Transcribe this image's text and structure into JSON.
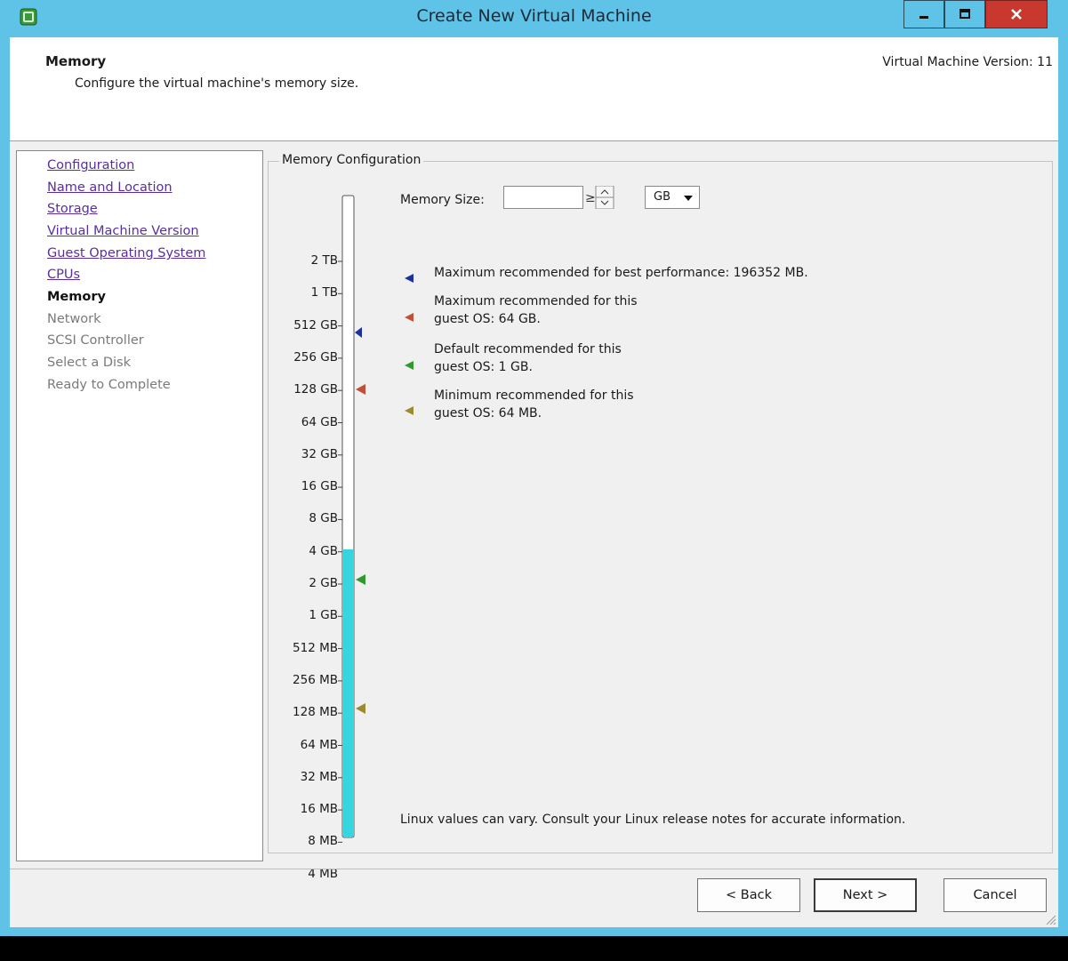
{
  "window": {
    "title": "Create New Virtual Machine",
    "app_icon": "vsphere-client-icon",
    "controls": {
      "minimize_icon": "minimize-icon",
      "maximize_icon": "maximize-icon",
      "close_icon": "close-icon"
    }
  },
  "header": {
    "title": "Memory",
    "subtitle": "Configure the virtual machine's memory size.",
    "version": "Virtual Machine Version: 11"
  },
  "steps": [
    {
      "label": "Configuration",
      "state": "done"
    },
    {
      "label": "Name and Location",
      "state": "done"
    },
    {
      "label": "Storage",
      "state": "done"
    },
    {
      "label": "Virtual Machine Version",
      "state": "done"
    },
    {
      "label": "Guest Operating System",
      "state": "done"
    },
    {
      "label": "CPUs",
      "state": "done"
    },
    {
      "label": "Memory",
      "state": "current"
    },
    {
      "label": "Network",
      "state": "pending"
    },
    {
      "label": "SCSI Controller",
      "state": "pending"
    },
    {
      "label": "Select a Disk",
      "state": "pending"
    },
    {
      "label": "Ready to Complete",
      "state": "pending"
    }
  ],
  "memory_config": {
    "group_label": "Memory Configuration",
    "size_label": "Memory Size:",
    "size_value": "",
    "unit": "GB",
    "scale_labels": [
      "2 TB",
      "1 TB",
      "512 GB",
      "256 GB",
      "128 GB",
      "64 GB",
      "32 GB",
      "16 GB",
      "8 GB",
      "4 GB",
      "2 GB",
      "1 GB",
      "512 MB",
      "256 MB",
      "128 MB",
      "64 MB",
      "32 MB",
      "16 MB",
      "8 MB",
      "4 MB"
    ],
    "slider_fill_upper_label": "2 GB",
    "legend": [
      {
        "line1": "Maximum recommended for best performance: 196352 MB.",
        "line2": "",
        "color": "#1f2f9e",
        "icon": "max-performance-marker-icon"
      },
      {
        "line1": "Maximum recommended for this",
        "line2": "guest OS: 64 GB.",
        "color": "#c0503a",
        "icon": "max-guest-marker-icon"
      },
      {
        "line1": "Default recommended for this",
        "line2": "guest OS: 1 GB.",
        "color": "#2e9a2e",
        "icon": "default-guest-marker-icon"
      },
      {
        "line1": "Minimum recommended for this",
        "line2": "guest OS: 64 MB.",
        "color": "#9a8a30",
        "icon": "min-guest-marker-icon"
      }
    ],
    "note": "Linux values can vary. Consult your Linux release notes for accurate information."
  },
  "buttons": {
    "back": "< Back",
    "next": "Next >",
    "cancel": "Cancel"
  },
  "colors": {
    "title_bar": "#5ec3e6",
    "slider_fill": "#36d6e0",
    "link": "#5a2ea0"
  }
}
